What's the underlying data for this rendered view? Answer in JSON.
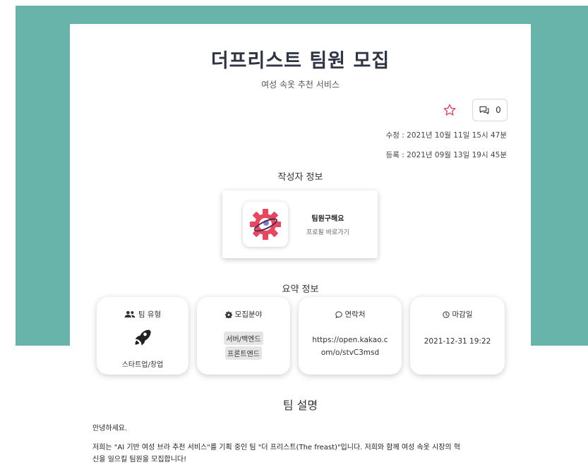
{
  "post": {
    "title": "더프리스트 팀원 모집",
    "subtitle": "여성 속옷 추천 서비스",
    "comment_count": "0",
    "updated": "수정 : 2021년 10월 11일 15시 47분",
    "created": "등록 : 2021년 09월 13일 19시 45분"
  },
  "writer": {
    "section_title": "작성자 정보",
    "name": "팀원구해요",
    "profile_link": "프로필 바로가기"
  },
  "summary": {
    "section_title": "요약 정보",
    "team_type": {
      "label": "팀 유형",
      "value": "스타트업/창업"
    },
    "field": {
      "label": "모집분야",
      "tags": [
        "서버/백엔드",
        "프론트엔드"
      ]
    },
    "contact": {
      "label": "연락처",
      "value_line1": "https://open.kakao.c",
      "value_line2": "om/o/stvC3msd"
    },
    "deadline": {
      "label": "마감일",
      "value": "2021-12-31 19:22"
    }
  },
  "description": {
    "title": "팀 설명",
    "p1": "안녕하세요.",
    "p2_line1": "저희는 \"AI 기반 여성 브라 추천 서비스\"를 기획 중인 팀 \"더 프리스트(The freast)\"입니다. 저희와 함께 여성 속옷 시장의 혁",
    "p2_line2": "신을 일으킬 팀원을 모집합니다!"
  },
  "colors": {
    "band": "#68b4ab",
    "star": "#e0405a",
    "gear": "#e8485f"
  },
  "icons": {
    "favorite": "star-outline-icon",
    "comment": "comment-icon",
    "team_type": "users-icon",
    "team_type_value": "rocket-icon",
    "field": "gear-icon",
    "contact": "chat-bubble-icon",
    "deadline": "clock-icon"
  }
}
